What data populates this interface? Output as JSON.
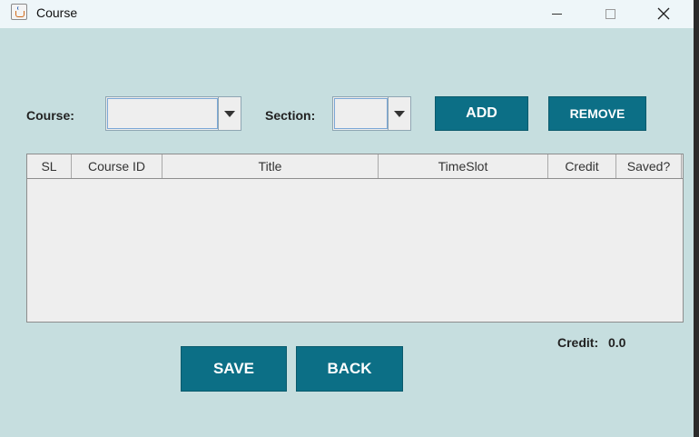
{
  "window": {
    "title": "Course",
    "icon": "java-cup-icon"
  },
  "form": {
    "course_label": "Course:",
    "course_value": "",
    "section_label": "Section:",
    "section_value": "",
    "add_label": "ADD",
    "remove_label": "REMOVE"
  },
  "table": {
    "columns": [
      "SL",
      "Course ID",
      "Title",
      "TimeSlot",
      "Credit",
      "Saved?"
    ],
    "rows": []
  },
  "footer": {
    "credit_label": "Credit:",
    "credit_value": "0.0",
    "save_label": "SAVE",
    "back_label": "BACK"
  },
  "colors": {
    "background": "#c6dedf",
    "button": "#0c6f86",
    "titlebar": "#eef6f9"
  }
}
